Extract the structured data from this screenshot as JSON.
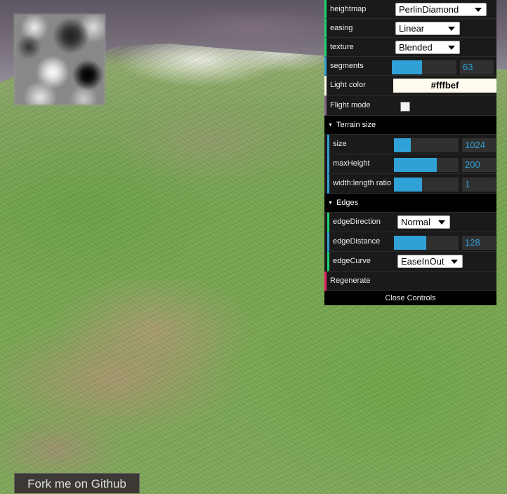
{
  "gui": {
    "rows": {
      "heightmap": {
        "label": "heightmap",
        "value": "PerlinDiamond"
      },
      "easing": {
        "label": "easing",
        "value": "Linear"
      },
      "texture": {
        "label": "texture",
        "value": "Blended"
      },
      "segments": {
        "label": "segments",
        "value": "63",
        "fraction": 0.47
      },
      "light_color": {
        "label": "Light color",
        "value": "#fffbef"
      },
      "flight_mode": {
        "label": "Flight mode",
        "checked": false
      }
    },
    "terrain_size": {
      "title": "Terrain size",
      "size": {
        "label": "size",
        "value": "1024",
        "fraction": 0.26
      },
      "max_height": {
        "label": "maxHeight",
        "value": "200",
        "fraction": 0.66
      },
      "width_length_ratio": {
        "label": "width:length ratio",
        "value": "1",
        "fraction": 0.44
      }
    },
    "edges": {
      "title": "Edges",
      "edge_direction": {
        "label": "edgeDirection",
        "value": "Normal"
      },
      "edge_distance": {
        "label": "edgeDistance",
        "value": "128",
        "fraction": 0.5
      },
      "edge_curve": {
        "label": "edgeCurve",
        "value": "EaseInOut"
      }
    },
    "regenerate_label": "Regenerate",
    "close_label": "Close Controls"
  },
  "fork_label": "Fork me on Github",
  "colors": {
    "string_accent": "#1ed36f",
    "number_accent": "#2fa1d6",
    "function_accent": "#e61d5f",
    "boolean_accent": "#806787",
    "light_color": "#fffbef"
  }
}
